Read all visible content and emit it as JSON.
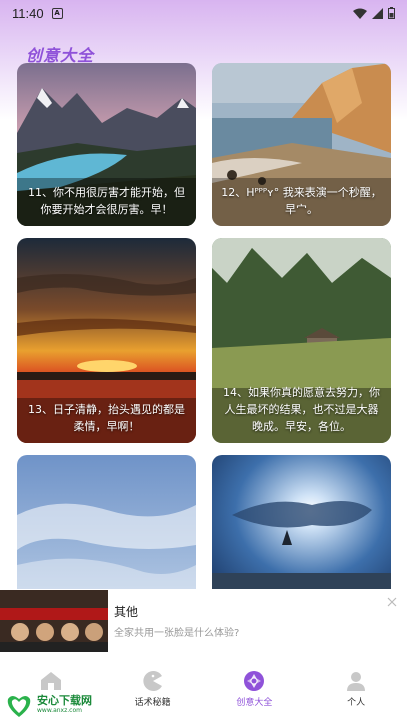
{
  "status_bar": {
    "time": "11:40",
    "notification_letter": "A"
  },
  "page_title": "创意大全",
  "cards": [
    {
      "caption": "11、你不用很厉害才能开始，但你要开始才会很厉害。早！"
    },
    {
      "caption": "12、Hᴾᴾᴾʏ° 我来表演一个秒醒，早宀。"
    },
    {
      "caption": "13、日子清静，抬头遇见的都是柔情，早啊！"
    },
    {
      "caption": "14、如果你真的愿意去努力，你人生最坏的结果，也不过是大器晚成。早安，各位。"
    },
    {
      "caption": ""
    },
    {
      "caption": ""
    }
  ],
  "ad": {
    "title": "其他",
    "subtitle": "全家共用一张脸是什么体验?"
  },
  "tabs": [
    {
      "label": "",
      "icon": "home-icon"
    },
    {
      "label": "话术秘籍",
      "icon": "pacman-icon"
    },
    {
      "label": "创意大全",
      "icon": "aperture-icon",
      "active": true
    },
    {
      "label": "个人",
      "icon": "person-icon"
    }
  ],
  "watermark": {
    "name": "安心下载网",
    "url": "www.anxz.com"
  },
  "colors": {
    "accent": "#8f52d9",
    "watermark_green": "#1b8a3a"
  }
}
